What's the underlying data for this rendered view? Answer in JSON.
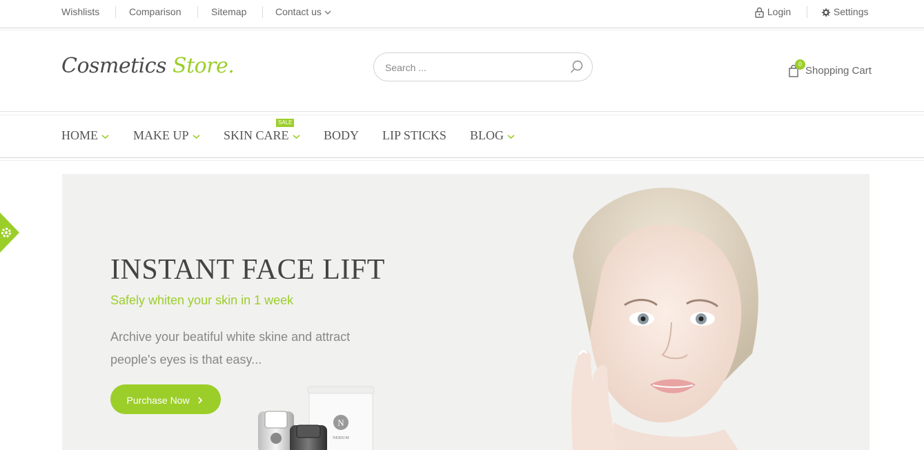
{
  "topbar": {
    "links": [
      "Wishlists",
      "Comparison",
      "Sitemap",
      "Contact us"
    ],
    "login": "Login",
    "settings": "Settings"
  },
  "header": {
    "logo_part1": "Cosmetics",
    "logo_part2": "Store.",
    "search_placeholder": "Search ...",
    "cart_count": "0",
    "cart_label": "Shopping Cart"
  },
  "nav": {
    "items": [
      "HOME",
      "MAKE UP",
      "SKIN CARE",
      "BODY",
      "LIP STICKS",
      "BLOG"
    ],
    "sale_badge": "SALE"
  },
  "hero": {
    "title": "INSTANT FACE LIFT",
    "subtitle": "Safely whiten your skin in 1 week",
    "description": "Archive your beatiful white skine and attract people's eyes is that easy...",
    "button": "Purchase Now",
    "product_brand": "N",
    "product_name": "NERIUM"
  },
  "colors": {
    "accent": "#9cce2a",
    "text": "#555555",
    "hero_bg": "#f1f1ef"
  },
  "icons": [
    "lock-icon",
    "gear-icon",
    "search-icon",
    "shopping-bag-icon",
    "chevron-down-icon",
    "chevron-right-icon"
  ]
}
